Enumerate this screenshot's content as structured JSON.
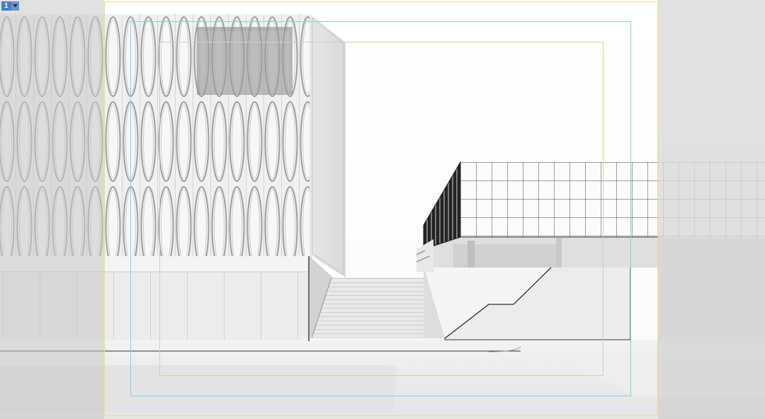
{
  "viewport": {
    "number_label": "1",
    "menu_icon": "chevron-down-icon",
    "scene_description_icon": "rendered-architecture-view"
  },
  "colors": {
    "background": "#d2d2d2",
    "safe_frame_outer": "#e8e08a",
    "safe_frame_action": "#7fd3e0",
    "safe_frame_title": "#d8d29a",
    "tab_blue": "#4b7fbf"
  }
}
